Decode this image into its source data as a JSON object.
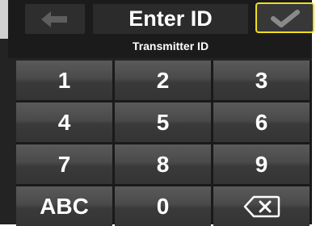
{
  "header": {
    "title": "Enter ID",
    "subtitle": "Transmitter ID",
    "back_icon": "arrow-left-icon",
    "confirm_icon": "checkmark-icon",
    "highlight_color": "#f0de1e"
  },
  "keypad": {
    "keys": [
      "1",
      "2",
      "3",
      "4",
      "5",
      "6",
      "7",
      "8",
      "9",
      "ABC",
      "0"
    ],
    "backspace_icon": "backspace-icon"
  }
}
